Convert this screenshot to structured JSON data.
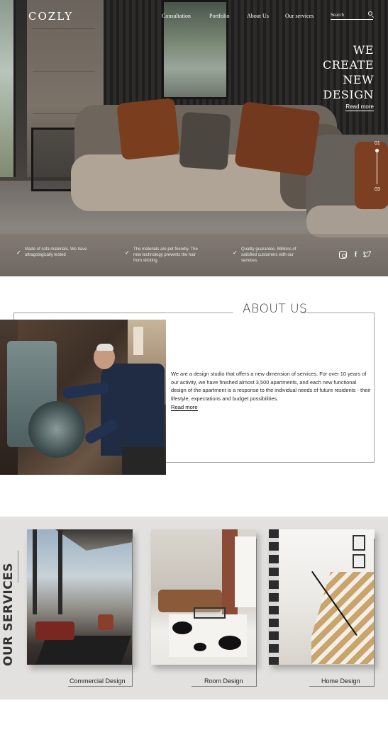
{
  "nav": {
    "logo": "COZLY",
    "links": [
      "Consultation",
      "Portfolio",
      "About Us",
      "Our services"
    ],
    "search_placeholder": "Search"
  },
  "hero": {
    "title_lines": [
      "WE",
      "CREATE",
      "NEW",
      "DESIGN"
    ],
    "read_more": "Read more",
    "slide_current": "01",
    "slide_total": "03",
    "features": [
      "Made of sofa materials. We have ultragologically tested",
      "The materials are pet friendly. The new technology prevents the hair from sticking",
      "Quality guarantee. Millions of satisfied customers with our services."
    ],
    "social_icons": [
      "instagram-icon",
      "facebook-icon",
      "twitter-icon"
    ]
  },
  "about": {
    "title": "ABOUT US",
    "text": "We are a design studio that offers a new dimension of services. For over 10 years of our activity, we have finished almost 3,500 apartments, and each new functional design of the apartment is a response to the individual needs of future residents - their lifestyle, expectations and budget possibilities.",
    "read_more": "Read more"
  },
  "services": {
    "title": "OUR SERVICES",
    "items": [
      "Commercial Design",
      "Room Design",
      "Home Design"
    ]
  },
  "colors": {
    "services_bg": "#e2e1df",
    "text_dark": "#222222",
    "hero_text": "#ffffff"
  }
}
